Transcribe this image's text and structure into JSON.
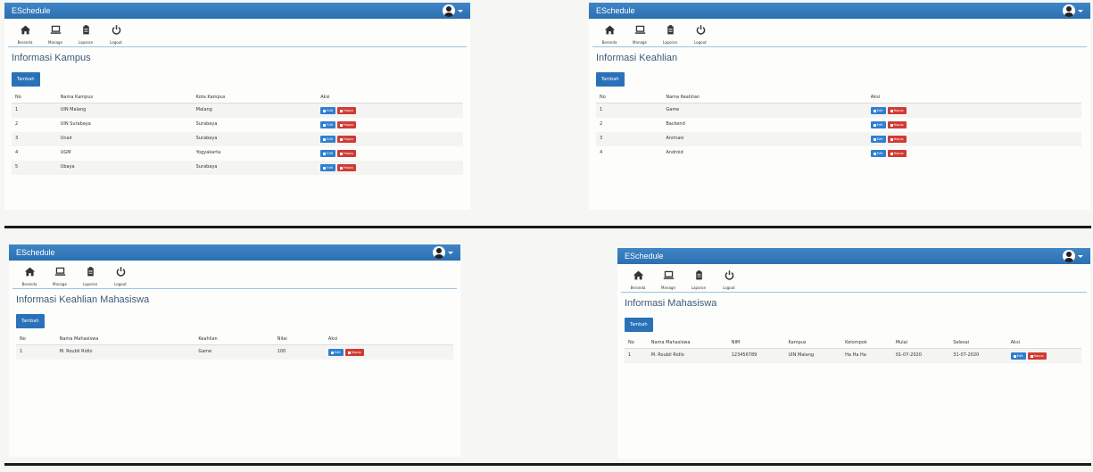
{
  "colors": {
    "accent": "#2b6fb0",
    "edit": "#2f7fd0",
    "delete": "#cf3b34",
    "divider": "#1a1a1a"
  },
  "app": {
    "brand": "ESchedule"
  },
  "nav": [
    {
      "label": "Beranda",
      "icon": "home-icon"
    },
    {
      "label": "Manage",
      "icon": "laptop-icon"
    },
    {
      "label": "Laporan",
      "icon": "clipboard-icon"
    },
    {
      "label": "Logout",
      "icon": "power-icon"
    }
  ],
  "panels": {
    "kampus": {
      "title": "Informasi Kampus",
      "add_label": "Tambah",
      "columns": [
        "No",
        "Nama Kampus",
        "Kota Kampus",
        "Aksi"
      ],
      "rows": [
        [
          "1",
          "UIN Malang",
          "Malang"
        ],
        [
          "2",
          "UIN Surabaya",
          "Surabaya"
        ],
        [
          "3",
          "Unair",
          "Surabaya"
        ],
        [
          "4",
          "UGM",
          "Yogyakarta"
        ],
        [
          "5",
          "Ubaya",
          "Surabaya"
        ]
      ]
    },
    "keahlian": {
      "title": "Informasi Keahlian",
      "add_label": "Tambah",
      "columns": [
        "No",
        "Nama Keahlian",
        "Aksi"
      ],
      "rows": [
        [
          "1",
          "Game"
        ],
        [
          "2",
          "Backend"
        ],
        [
          "3",
          "Animasi"
        ],
        [
          "4",
          "Android"
        ]
      ]
    },
    "keahlian_mhs": {
      "title": "Informasi Keahlian Mahasiswa",
      "add_label": "Tambah",
      "columns": [
        "No",
        "Nama Mahasiswa",
        "Keahlian",
        "Nilai",
        "Aksi"
      ],
      "rows": [
        [
          "1",
          "M. Roubil Ridlo",
          "Game",
          "100"
        ]
      ]
    },
    "mahasiswa": {
      "title": "Informasi Mahasiswa",
      "add_label": "Tambah",
      "columns": [
        "No",
        "Nama Mahasiswa",
        "NIM",
        "Kampus",
        "Kelompok",
        "Mulai",
        "Selesai",
        "Aksi"
      ],
      "rows": [
        [
          "1",
          "M. Roubil Ridlo",
          "123456789",
          "UIN Malang",
          "Ha Ha Ha",
          "01-07-2020",
          "31-07-2020"
        ]
      ]
    }
  },
  "actions": {
    "edit_label": "Edit",
    "delete_label": "Hapus"
  }
}
